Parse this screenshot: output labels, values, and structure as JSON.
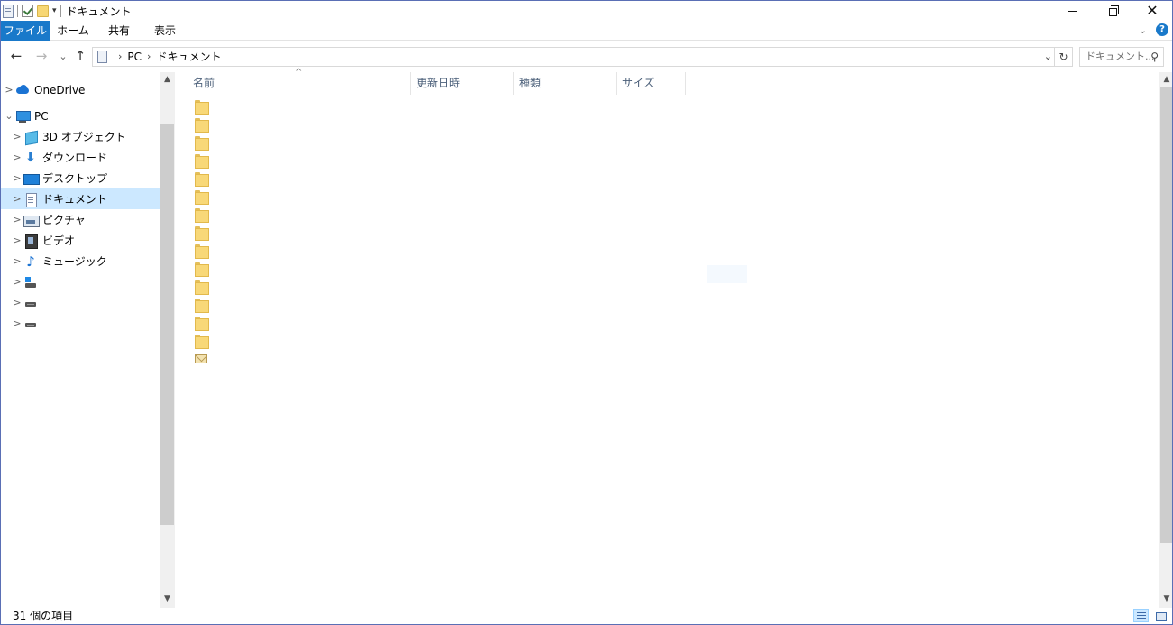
{
  "window": {
    "title": "ドキュメント",
    "controls": {
      "minimize": "",
      "restore": "",
      "close": "✕"
    }
  },
  "ribbon": {
    "tabs": [
      "ファイル",
      "ホーム",
      "共有",
      "表示"
    ]
  },
  "nav": {
    "back": "←",
    "forward": "→",
    "recent": "⌄",
    "up": "↑"
  },
  "address": {
    "crumbs": [
      "PC",
      "ドキュメント"
    ],
    "separator": "›"
  },
  "search": {
    "placeholder": "ドキュメント..."
  },
  "tree": [
    {
      "label": "OneDrive",
      "icon": "onedrive-cloud-icon",
      "chevron": ">",
      "indent": 0,
      "selected": false
    },
    {
      "label": "PC",
      "icon": "pc-monitor-icon",
      "chevron": "⌄",
      "indent": 0,
      "selected": false
    },
    {
      "label": "3D オブジェクト",
      "icon": "3d-objects-icon",
      "chevron": ">",
      "indent": 1,
      "selected": false
    },
    {
      "label": "ダウンロード",
      "icon": "download-icon",
      "chevron": ">",
      "indent": 1,
      "selected": false
    },
    {
      "label": "デスクトップ",
      "icon": "desktop-icon",
      "chevron": ">",
      "indent": 1,
      "selected": false
    },
    {
      "label": "ドキュメント",
      "icon": "document-icon",
      "chevron": ">",
      "indent": 1,
      "selected": true
    },
    {
      "label": "ピクチャ",
      "icon": "pictures-icon",
      "chevron": ">",
      "indent": 1,
      "selected": false
    },
    {
      "label": "ビデオ",
      "icon": "video-icon",
      "chevron": ">",
      "indent": 1,
      "selected": false
    },
    {
      "label": "ミュージック",
      "icon": "music-icon",
      "chevron": ">",
      "indent": 1,
      "selected": false
    },
    {
      "label": "",
      "icon": "windows-drive-icon",
      "chevron": ">",
      "indent": 1,
      "selected": false
    },
    {
      "label": "",
      "icon": "drive-icon",
      "chevron": ">",
      "indent": 1,
      "selected": false
    },
    {
      "label": "",
      "icon": "drive-icon",
      "chevron": ">",
      "indent": 1,
      "selected": false
    }
  ],
  "columns": [
    "名前",
    "更新日時",
    "種類",
    "サイズ"
  ],
  "files": [
    {
      "icon": "folder-icon"
    },
    {
      "icon": "folder-icon"
    },
    {
      "icon": "folder-icon"
    },
    {
      "icon": "folder-icon"
    },
    {
      "icon": "folder-icon"
    },
    {
      "icon": "folder-icon"
    },
    {
      "icon": "folder-icon"
    },
    {
      "icon": "folder-icon"
    },
    {
      "icon": "folder-icon"
    },
    {
      "icon": "folder-icon"
    },
    {
      "icon": "folder-icon"
    },
    {
      "icon": "folder-icon"
    },
    {
      "icon": "folder-icon"
    },
    {
      "icon": "folder-icon"
    },
    {
      "icon": "mail-envelope-icon"
    }
  ],
  "status": {
    "item_count": "31 個の項目"
  },
  "colors": {
    "accent": "#1979ca",
    "selection": "#cce8ff",
    "folder": "#f8d878"
  }
}
